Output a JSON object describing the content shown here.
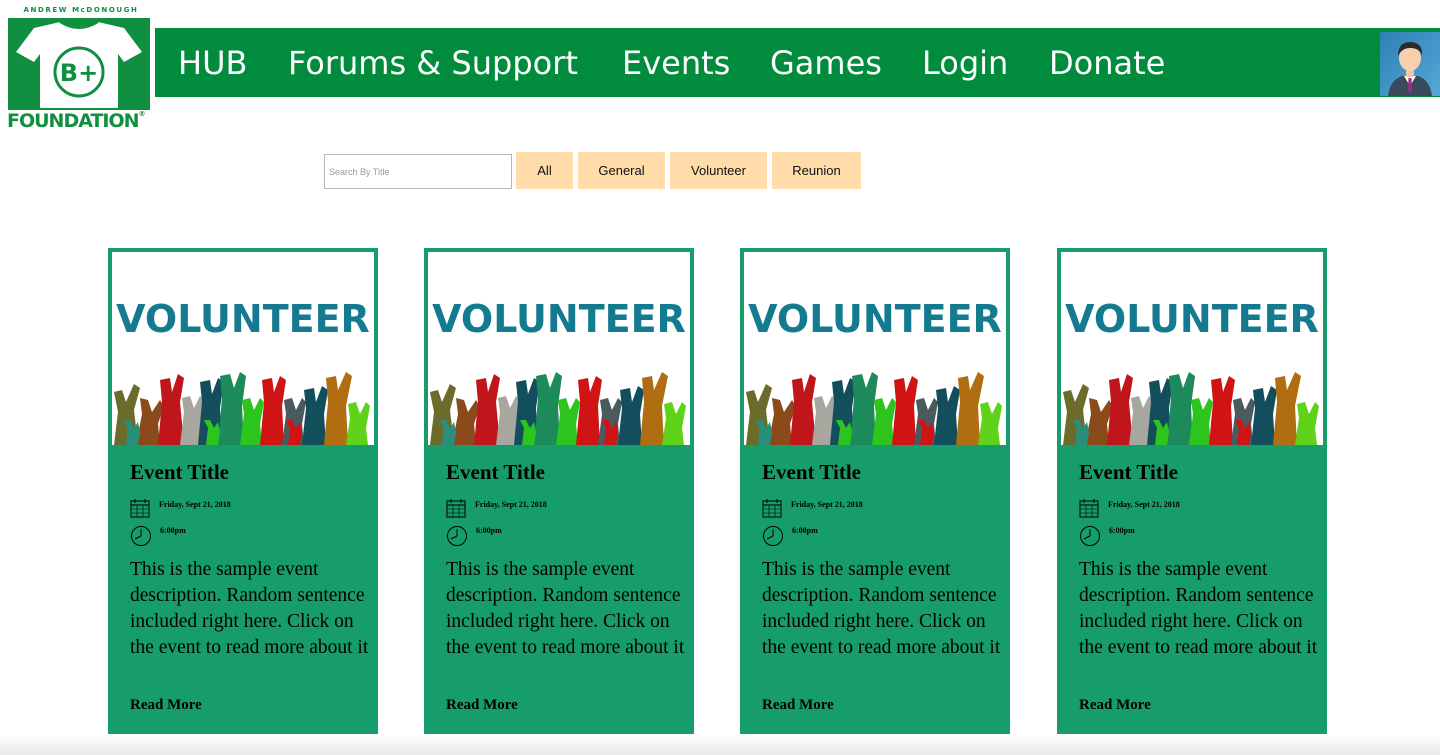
{
  "logo": {
    "top_text": "ANDREW McDONOUGH",
    "shirt_text": "B+",
    "bottom_text": "FOUNDATION",
    "registered": "®",
    "color": "#0f8f3f"
  },
  "nav": {
    "color": "#008c3c",
    "items": [
      {
        "label": "HUB"
      },
      {
        "label": "Forums & Support"
      },
      {
        "label": "Events"
      },
      {
        "label": "Games"
      },
      {
        "label": "Login"
      },
      {
        "label": "Donate"
      }
    ],
    "avatar_icon": "user-avatar-icon"
  },
  "filters": {
    "search_placeholder": "Search By Title",
    "buttons": [
      {
        "label": "All"
      },
      {
        "label": "General"
      },
      {
        "label": "Volunteer"
      },
      {
        "label": "Reunion"
      }
    ],
    "button_color": "#ffdcaa"
  },
  "cards": [
    {
      "image_text": "VOLUNTEER",
      "title": "Event Title",
      "date": "Friday, Sept 21, 2018",
      "time": "6:00pm",
      "description": "This is the sample event description. Random sentence included right here. Click on the event to read more about it",
      "read_more": "Read More"
    },
    {
      "image_text": "VOLUNTEER",
      "title": "Event Title",
      "date": "Friday, Sept 21, 2018",
      "time": "6:00pm",
      "description": "This is the sample event description. Random sentence included right here. Click on the event to read more about it",
      "read_more": "Read More"
    },
    {
      "image_text": "VOLUNTEER",
      "title": "Event Title",
      "date": "Friday, Sept 21, 2018",
      "time": "6:00pm",
      "description": "This is the sample event description. Random sentence included right here. Click on the event to read more about it",
      "read_more": "Read More"
    },
    {
      "image_text": "VOLUNTEER",
      "title": "Event Title",
      "date": "Friday, Sept 21, 2018",
      "time": "6:00pm",
      "description": "This is the sample event description. Random sentence included right here. Click on the event to read more about it",
      "read_more": "Read More"
    }
  ],
  "card_color": "#169d6b"
}
